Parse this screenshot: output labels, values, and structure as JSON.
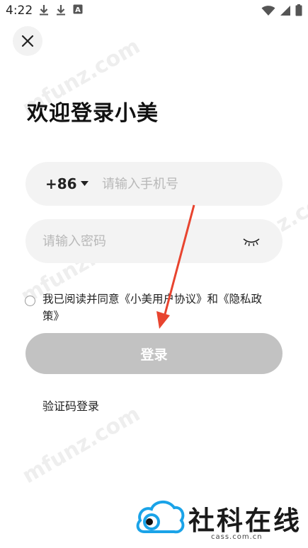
{
  "status_bar": {
    "time": "4:22",
    "left_icons": [
      "download-icon",
      "download-icon",
      "text-a-icon"
    ],
    "right_icons": [
      "wifi-icon",
      "signal-icon",
      "battery-icon"
    ]
  },
  "header": {
    "close_icon": "close-icon",
    "title": "欢迎登录小美"
  },
  "form": {
    "phone": {
      "country_code": "+86",
      "placeholder": "请输入手机号",
      "value": ""
    },
    "password": {
      "placeholder": "请输入密码",
      "value": "",
      "toggle_icon": "eye-closed-icon"
    },
    "agreement": {
      "checked": false,
      "text": "我已阅读并同意《小美用户协议》和《隐私政策》"
    },
    "login_button": "登录",
    "code_login_link": "验证码登录"
  },
  "watermarks": [
    "mfunz.com",
    "mfunz.com",
    "mfunz.com",
    "mfunz.com"
  ],
  "brand": {
    "name": "社科在线",
    "domain": "cass.com.cn"
  },
  "colors": {
    "field_bg": "#f3f3f3",
    "button_disabled": "#c2c2c2",
    "annotation_arrow": "#e8442f",
    "brand_logo": "#1aa3e8"
  }
}
